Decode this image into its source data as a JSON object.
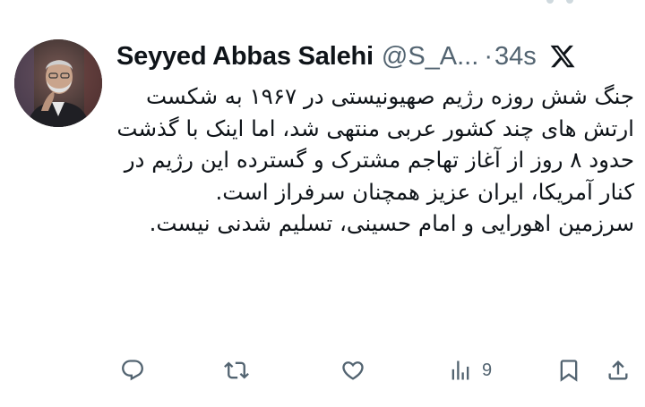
{
  "author": {
    "name": "Seyyed Abbas Salehi",
    "handle": "@S_A...",
    "separator": "·",
    "time": "34s"
  },
  "tweet": {
    "paragraphs": [
      "جنگ شش روزه رژیم صهیونیستی در ۱۹۶۷ به شکست ارتش های چند کشور عربی منتهی شد، اما اینک با گذشت حدود ۸ روز از آغاز تهاجم مشترک و گسترده این رژیم در کنار آمریکا، ایران عزیز همچنان سرفراز است.",
      "سرزمین اهورایی و امام حسینی، تسلیم شدنی نیست."
    ]
  },
  "actions": {
    "views_count": "9"
  },
  "icons": {
    "platform": "x-logo-icon",
    "reply": "reply-icon",
    "repost": "repost-icon",
    "like": "heart-icon",
    "views": "views-icon",
    "bookmark": "bookmark-icon",
    "share": "share-icon"
  },
  "colors": {
    "text": "#0f1419",
    "secondary": "#536471",
    "background": "#ffffff"
  }
}
